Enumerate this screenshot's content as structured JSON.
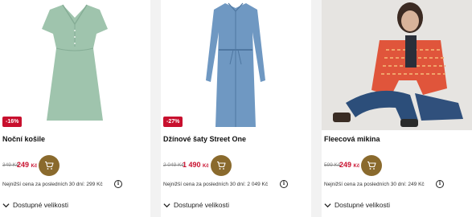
{
  "products": [
    {
      "title": "Noční košile",
      "badge": "-16%",
      "old_price": "349 Kč",
      "new_price": "249",
      "currency": "Kč",
      "note": "Nejnižší cena za posledních 30 dní: 299 Kč",
      "sizes_label": "Dostupné velikosti"
    },
    {
      "title": "Džínové šaty Street One",
      "badge": "-27%",
      "old_price": "2 049 Kč",
      "new_price": "1 490",
      "currency": "Kč",
      "note": "Nejnižší cena za posledních 30 dní: 2 049 Kč",
      "sizes_label": "Dostupné velikosti"
    },
    {
      "title": "Fleecová mikina",
      "badge": "",
      "old_price": "599 Kč",
      "new_price": "249",
      "currency": "Kč",
      "note": "Nejnižší cena za posledních 30 dní: 249 Kč",
      "sizes_label": "Dostupné velikosti"
    }
  ],
  "icons": {
    "cart": "shopping-cart-icon",
    "info": "info-icon",
    "chevron": "chevron-down-icon"
  },
  "colors": {
    "discount": "#c8102e",
    "cart_button": "#8a6a2d",
    "background": "#f2f2f2"
  }
}
